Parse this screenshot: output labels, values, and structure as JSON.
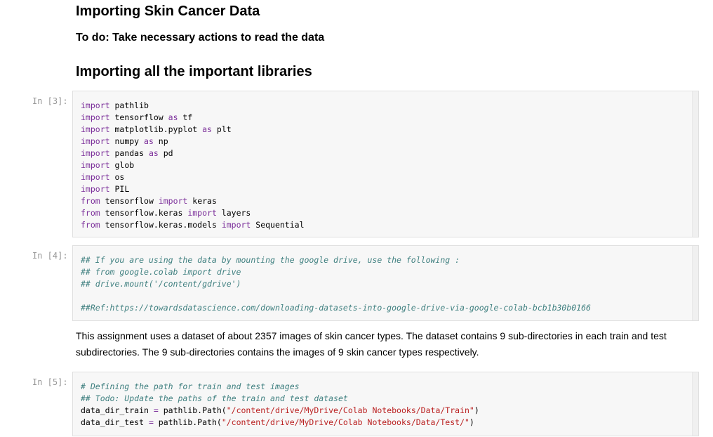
{
  "headings": {
    "title": "Importing Skin Cancer Data",
    "todo": "To do: Take necessary actions to read the data",
    "libraries": "Importing all the important libraries"
  },
  "cells": [
    {
      "prompt": "In [3]:",
      "lines": [
        [
          {
            "k": "kw",
            "t": "import"
          },
          {
            "k": "",
            "t": " pathlib"
          }
        ],
        [
          {
            "k": "kw",
            "t": "import"
          },
          {
            "k": "",
            "t": " tensorflow "
          },
          {
            "k": "kw",
            "t": "as"
          },
          {
            "k": "",
            "t": " tf"
          }
        ],
        [
          {
            "k": "kw",
            "t": "import"
          },
          {
            "k": "",
            "t": " matplotlib.pyplot "
          },
          {
            "k": "kw",
            "t": "as"
          },
          {
            "k": "",
            "t": " plt"
          }
        ],
        [
          {
            "k": "kw",
            "t": "import"
          },
          {
            "k": "",
            "t": " numpy "
          },
          {
            "k": "kw",
            "t": "as"
          },
          {
            "k": "",
            "t": " np"
          }
        ],
        [
          {
            "k": "kw",
            "t": "import"
          },
          {
            "k": "",
            "t": " pandas "
          },
          {
            "k": "kw",
            "t": "as"
          },
          {
            "k": "",
            "t": " pd"
          }
        ],
        [
          {
            "k": "kw",
            "t": "import"
          },
          {
            "k": "",
            "t": " glob"
          }
        ],
        [
          {
            "k": "kw",
            "t": "import"
          },
          {
            "k": "",
            "t": " os"
          }
        ],
        [
          {
            "k": "kw",
            "t": "import"
          },
          {
            "k": "",
            "t": " PIL"
          }
        ],
        [
          {
            "k": "kw",
            "t": "from"
          },
          {
            "k": "",
            "t": " tensorflow "
          },
          {
            "k": "kw",
            "t": "import"
          },
          {
            "k": "",
            "t": " keras"
          }
        ],
        [
          {
            "k": "kw",
            "t": "from"
          },
          {
            "k": "",
            "t": " tensorflow.keras "
          },
          {
            "k": "kw",
            "t": "import"
          },
          {
            "k": "",
            "t": " layers"
          }
        ],
        [
          {
            "k": "kw",
            "t": "from"
          },
          {
            "k": "",
            "t": " tensorflow.keras.models "
          },
          {
            "k": "kw",
            "t": "import"
          },
          {
            "k": "",
            "t": " Sequential"
          }
        ]
      ]
    },
    {
      "prompt": "In [4]:",
      "lines": [
        [
          {
            "k": "cm",
            "t": "## If you are using the data by mounting the google drive, use the following :"
          }
        ],
        [
          {
            "k": "cm",
            "t": "## from google.colab import drive"
          }
        ],
        [
          {
            "k": "cm",
            "t": "## drive.mount('/content/gdrive')"
          }
        ],
        [
          {
            "k": "",
            "t": ""
          }
        ],
        [
          {
            "k": "cm",
            "t": "##Ref:https://towardsdatascience.com/downloading-datasets-into-google-drive-via-google-colab-bcb1b30b0166"
          }
        ]
      ]
    },
    {
      "prompt": "In [5]:",
      "lines": [
        [
          {
            "k": "cm",
            "t": "# Defining the path for train and test images"
          }
        ],
        [
          {
            "k": "cm",
            "t": "## Todo: Update the paths of the train and test dataset"
          }
        ],
        [
          {
            "k": "",
            "t": "data_dir_train "
          },
          {
            "k": "op",
            "t": "="
          },
          {
            "k": "",
            "t": " pathlib.Path("
          },
          {
            "k": "str",
            "t": "\"/content/drive/MyDrive/Colab Notebooks/Data/Train\""
          },
          {
            "k": "",
            "t": ")"
          }
        ],
        [
          {
            "k": "",
            "t": "data_dir_test "
          },
          {
            "k": "op",
            "t": "="
          },
          {
            "k": "",
            "t": " pathlib.Path("
          },
          {
            "k": "str",
            "t": "\"/content/drive/MyDrive/Colab Notebooks/Data/Test/\""
          },
          {
            "k": "",
            "t": ")"
          }
        ]
      ]
    }
  ],
  "description": "This assignment uses a dataset of about 2357 images of skin cancer types. The dataset contains 9 sub-directories in each train and test subdirectories. The 9 sub-directories contains the images of 9 skin cancer types respectively."
}
